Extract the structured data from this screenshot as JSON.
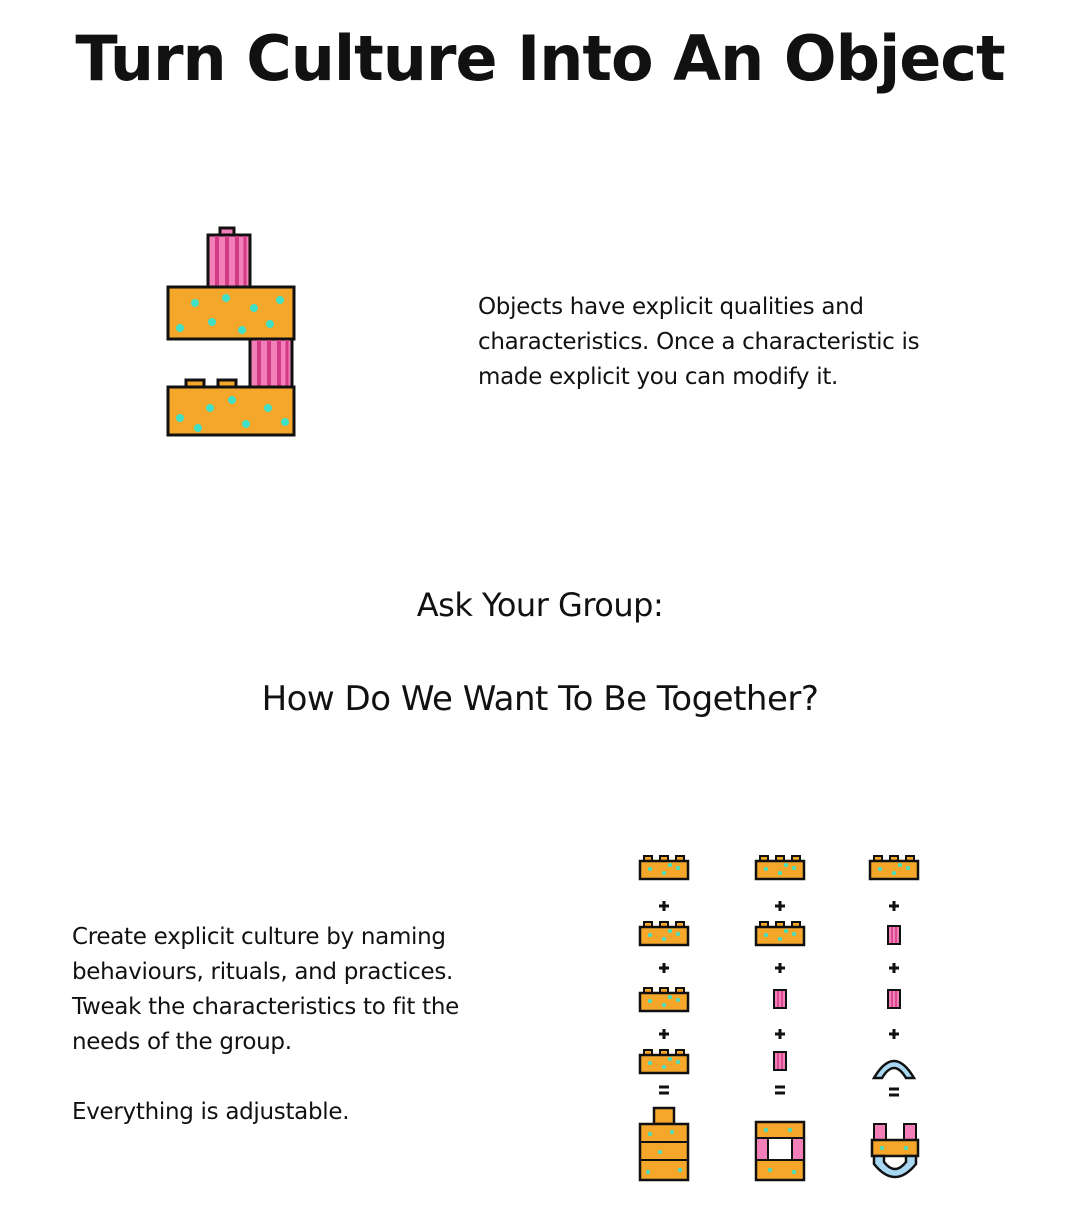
{
  "title": "Turn Culture Into An Object",
  "intro": {
    "text": "Objects have explicit qualities and characteristics. Once a characteristic is made explicit you can modify it.",
    "illustration_icon": "stacked-blocks-icon"
  },
  "prompt": {
    "heading": "Ask Your Group:",
    "question": "How Do We Want To Be Together?"
  },
  "detail": {
    "lines": [
      "Create explicit culture by naming behaviours, rituals, and practices. Tweak the characteristics to fit the needs of the group."
    ],
    "closing": "Everything is adjustable.",
    "illustration_icon": "block-equations-icon"
  },
  "colors": {
    "orange_block": "#f4a72a",
    "dots": "#3fe0c5",
    "pink_block": "#f47fb8",
    "pink_stripe": "#d13b86",
    "blue_arch": "#a9d8f2",
    "outline": "#111111"
  }
}
